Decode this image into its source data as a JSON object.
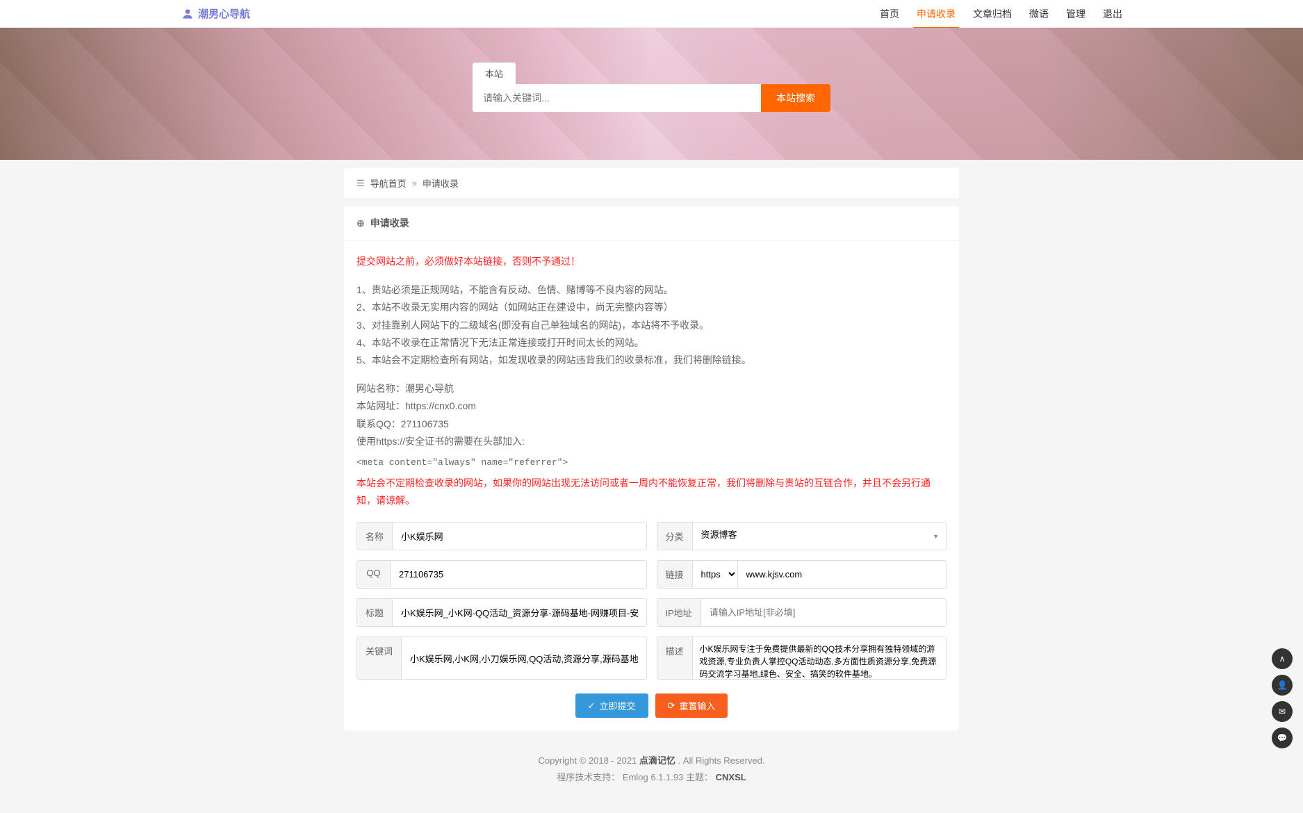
{
  "logo": {
    "text": "潮男心导航"
  },
  "nav": {
    "items": [
      {
        "label": "首页",
        "active": false
      },
      {
        "label": "申请收录",
        "active": true
      },
      {
        "label": "文章归档",
        "active": false
      },
      {
        "label": "微语",
        "active": false
      },
      {
        "label": "管理",
        "active": false
      },
      {
        "label": "退出",
        "active": false
      }
    ]
  },
  "search": {
    "tab": "本站",
    "placeholder": "请输入关键词...",
    "button": "本站搜索"
  },
  "breadcrumb": {
    "home": "导航首页",
    "sep": "»",
    "current": "申请收录"
  },
  "panel": {
    "title": "申请收录",
    "warning1": "提交网站之前，必须做好本站链接，否则不予通过！",
    "rules": [
      "1、贵站必须是正规网站，不能含有反动、色情、赌博等不良内容的网站。",
      "2、本站不收录无实用内容的网站（如网站正在建设中，尚无完整内容等）",
      "3、对挂靠别人网站下的二级域名(即没有自己单独域名的网站)，本站将不予收录。",
      "4、本站不收录在正常情况下无法正常连接或打开时间太长的网站。",
      "5、本站会不定期检查所有网站，如发现收录的网站违背我们的收录标准，我们将删除链接。"
    ],
    "siteInfo": [
      "网站名称：潮男心导航",
      "本站网址：https://cnx0.com",
      "联系QQ：271106735",
      "使用https://安全证书的需要在头部加入:"
    ],
    "meta": "<meta content=\"always\" name=\"referrer\">",
    "warning2": "本站会不定期检查收录的网站，如果你的网站出现无法访问或者一周内不能恢复正常，我们将删除与贵站的互链合作，并且不会另行通知，请谅解。"
  },
  "form": {
    "name": {
      "label": "名称",
      "value": "小K娱乐网"
    },
    "category": {
      "label": "分类",
      "value": "资源博客"
    },
    "qq": {
      "label": "QQ",
      "value": "271106735"
    },
    "link": {
      "label": "链接",
      "protocol": "https://",
      "value": "www.kjsv.com"
    },
    "title": {
      "label": "标题",
      "value": "小K娱乐网_小K网-QQ活动_资源分享-源码基地-网赚项目-安卓绿色软件基地"
    },
    "ip": {
      "label": "IP地址",
      "placeholder": "请输入IP地址[非必填]"
    },
    "keywords": {
      "label": "关键词",
      "value": "小K娱乐网,小K网,小刀娱乐网,QQ活动,资源分享,源码基地,网赚项目,软件基地"
    },
    "desc": {
      "label": "描述",
      "value": "小K娱乐网专注于免费提供最新的QQ技术分享拥有独特领域的游戏资源,专业负责人掌控QQ活动动态,多方面性质资源分享,免费源码交流学习基地,绿色、安全、搞笑的软件基地。"
    }
  },
  "buttons": {
    "submit": "立即提交",
    "reset": "重置输入"
  },
  "footer": {
    "copyright": "Copyright © 2018 - 2021 ",
    "siteName": "点滴记忆",
    "rights": ". All Rights Reserved.",
    "line2a": "程序技术支持：",
    "engine": "Emlog 6.1.1.93",
    "line2b": " 主题：",
    "theme": "CNXSL"
  }
}
